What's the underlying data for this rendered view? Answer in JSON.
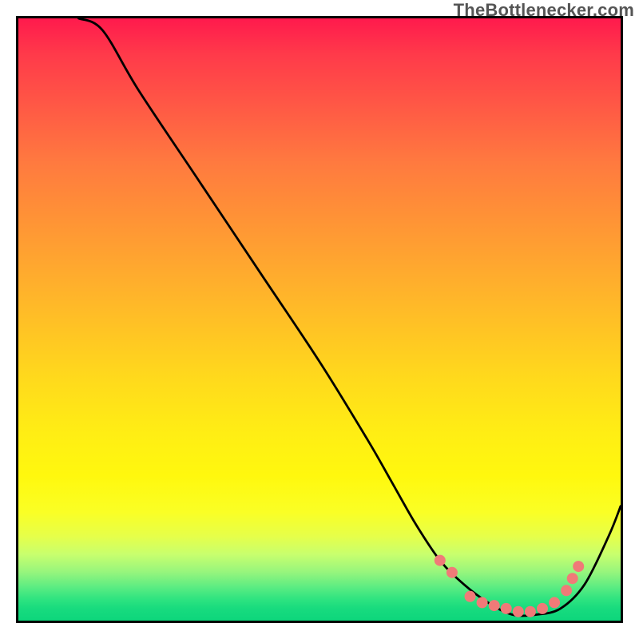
{
  "watermark": "TheBottlenecker.com",
  "chart_data": {
    "type": "line",
    "title": "",
    "xlabel": "",
    "ylabel": "",
    "xlim": [
      0,
      100
    ],
    "ylim": [
      0,
      100
    ],
    "gradient_stops": [
      {
        "pos": 0.0,
        "color": "#ff1a4d"
      },
      {
        "pos": 0.06,
        "color": "#ff3a4a"
      },
      {
        "pos": 0.15,
        "color": "#ff5a45"
      },
      {
        "pos": 0.24,
        "color": "#ff7a3f"
      },
      {
        "pos": 0.33,
        "color": "#ff9236"
      },
      {
        "pos": 0.42,
        "color": "#ffaa2e"
      },
      {
        "pos": 0.51,
        "color": "#ffc225"
      },
      {
        "pos": 0.6,
        "color": "#ffda1c"
      },
      {
        "pos": 0.69,
        "color": "#ffee14"
      },
      {
        "pos": 0.76,
        "color": "#fff80e"
      },
      {
        "pos": 0.82,
        "color": "#faff25"
      },
      {
        "pos": 0.86,
        "color": "#e6ff4a"
      },
      {
        "pos": 0.89,
        "color": "#c8ff6e"
      },
      {
        "pos": 0.92,
        "color": "#95f57d"
      },
      {
        "pos": 0.945,
        "color": "#5aec82"
      },
      {
        "pos": 0.965,
        "color": "#2de380"
      },
      {
        "pos": 0.98,
        "color": "#18db7e"
      },
      {
        "pos": 1.0,
        "color": "#0dd67c"
      }
    ],
    "series": [
      {
        "name": "bottleneck-curve",
        "x": [
          10,
          14,
          20,
          30,
          40,
          50,
          58,
          62,
          66,
          70,
          74,
          78,
          82,
          86,
          90,
          94,
          98,
          100
        ],
        "y": [
          100,
          98,
          88,
          73,
          58,
          43,
          30,
          23,
          16,
          10,
          6,
          3,
          1,
          1,
          2,
          6,
          14,
          19
        ]
      }
    ],
    "markers": {
      "name": "highlight-dots",
      "color": "#f07a78",
      "points": [
        {
          "x": 70,
          "y": 10
        },
        {
          "x": 72,
          "y": 8
        },
        {
          "x": 75,
          "y": 4
        },
        {
          "x": 77,
          "y": 3
        },
        {
          "x": 79,
          "y": 2.5
        },
        {
          "x": 81,
          "y": 2
        },
        {
          "x": 83,
          "y": 1.5
        },
        {
          "x": 85,
          "y": 1.5
        },
        {
          "x": 87,
          "y": 2
        },
        {
          "x": 89,
          "y": 3
        },
        {
          "x": 91,
          "y": 5
        },
        {
          "x": 92,
          "y": 7
        },
        {
          "x": 93,
          "y": 9
        }
      ]
    }
  }
}
